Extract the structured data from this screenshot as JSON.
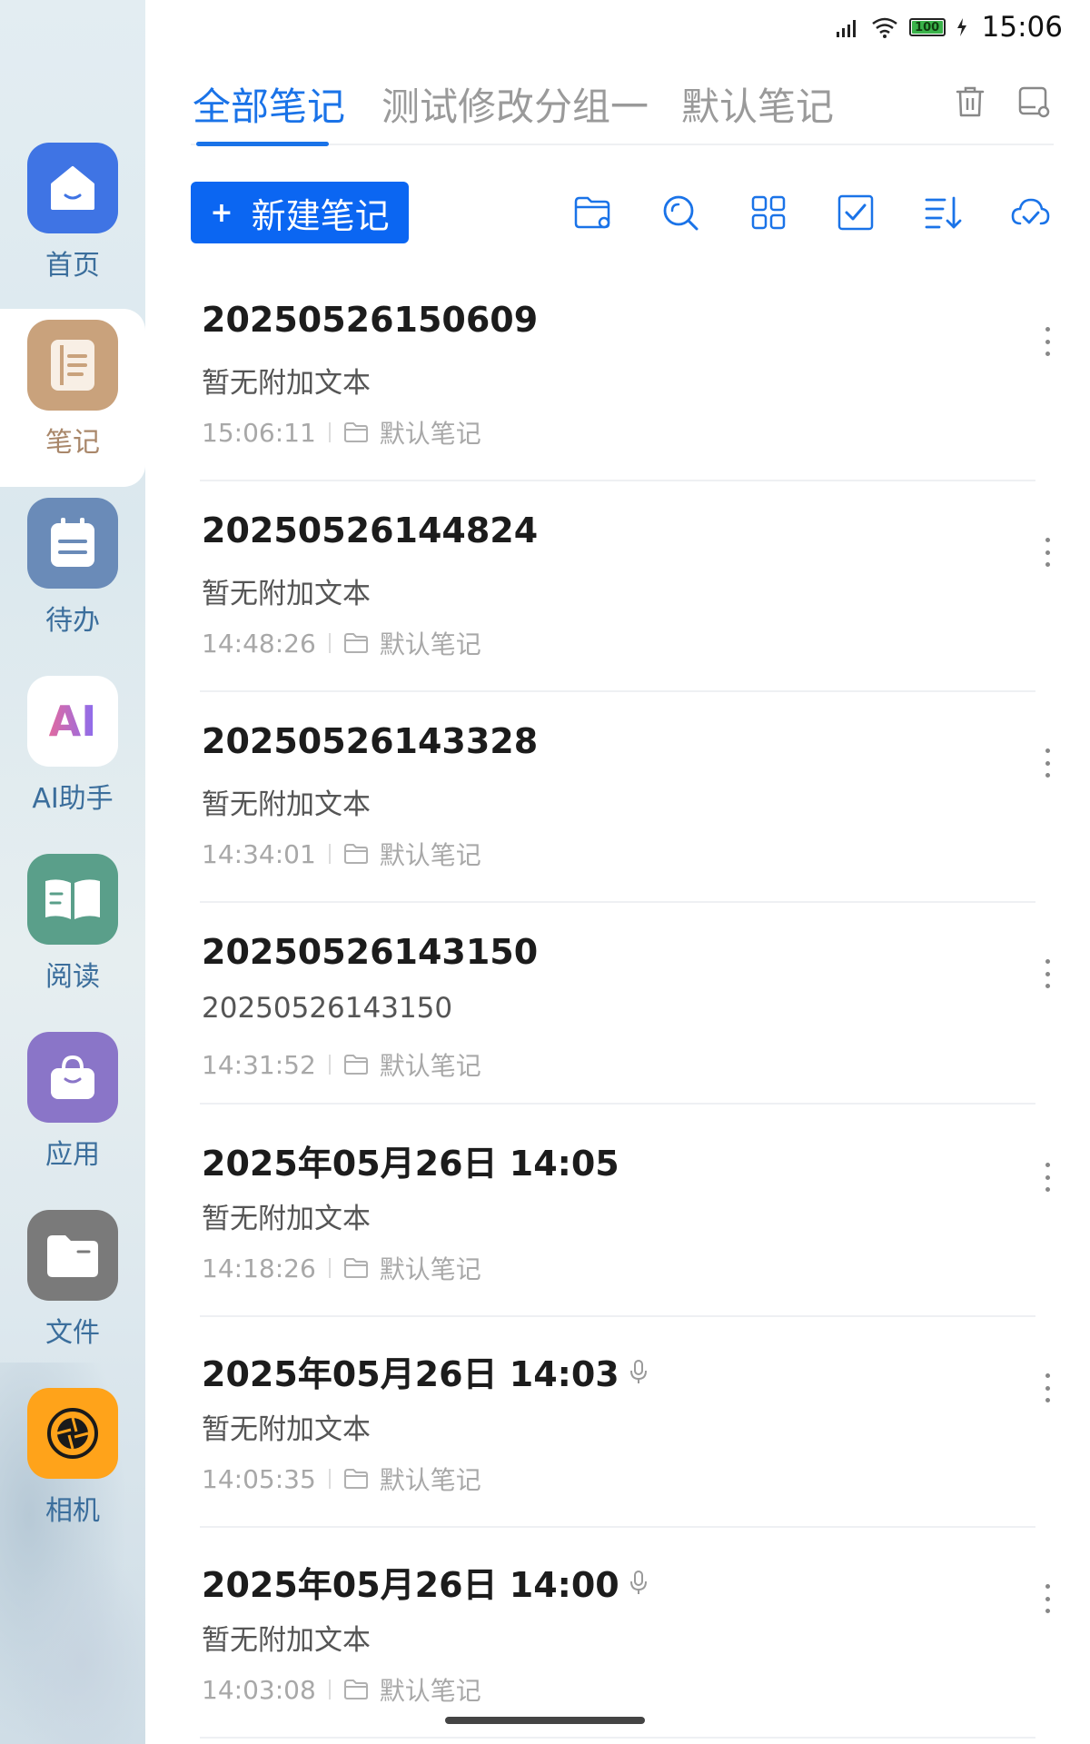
{
  "status_bar": {
    "time": "15:06",
    "battery": "100"
  },
  "sidebar": {
    "items": [
      {
        "label": "首页",
        "icon": "home-icon",
        "color": "#3f74e4"
      },
      {
        "label": "笔记",
        "icon": "notes-icon",
        "color": "#c9a27c"
      },
      {
        "label": "待办",
        "icon": "todo-icon",
        "color": "#6a8bb8"
      },
      {
        "label": "AI助手",
        "icon": "ai-icon",
        "color": "#ffffff",
        "glyph": "AI"
      },
      {
        "label": "阅读",
        "icon": "reading-icon",
        "color": "#5a9f8a"
      },
      {
        "label": "应用",
        "icon": "apps-icon",
        "color": "#8a75c8"
      },
      {
        "label": "文件",
        "icon": "files-icon",
        "color": "#7a7a7a"
      },
      {
        "label": "相机",
        "icon": "camera-icon",
        "color": "#ffa31a"
      }
    ]
  },
  "tabs": [
    "全部笔记",
    "测试修改分组一",
    "默认笔记"
  ],
  "toolbar": {
    "new_note_label": "新建笔记",
    "new_note_plus": "+"
  },
  "notes": [
    {
      "title": "20250526150609",
      "subtitle": "暂无附加文本",
      "time": "15:06:11",
      "folder": "默认笔记",
      "has_audio": false
    },
    {
      "title": "20250526144824",
      "subtitle": "暂无附加文本",
      "time": "14:48:26",
      "folder": "默认笔记",
      "has_audio": false
    },
    {
      "title": "20250526143328",
      "subtitle": "暂无附加文本",
      "time": "14:34:01",
      "folder": "默认笔记",
      "has_audio": false
    },
    {
      "title": "20250526143150",
      "subtitle": "20250526143150",
      "time": "14:31:52",
      "folder": "默认笔记",
      "has_audio": false
    },
    {
      "title": "2025年05月26日 14:05",
      "subtitle": "暂无附加文本",
      "time": "14:18:26",
      "folder": "默认笔记",
      "has_audio": false
    },
    {
      "title": "2025年05月26日 14:03",
      "subtitle": "暂无附加文本",
      "time": "14:05:35",
      "folder": "默认笔记",
      "has_audio": true
    },
    {
      "title": "2025年05月26日 14:00",
      "subtitle": "暂无附加文本",
      "time": "14:03:08",
      "folder": "默认笔记",
      "has_audio": true
    }
  ]
}
